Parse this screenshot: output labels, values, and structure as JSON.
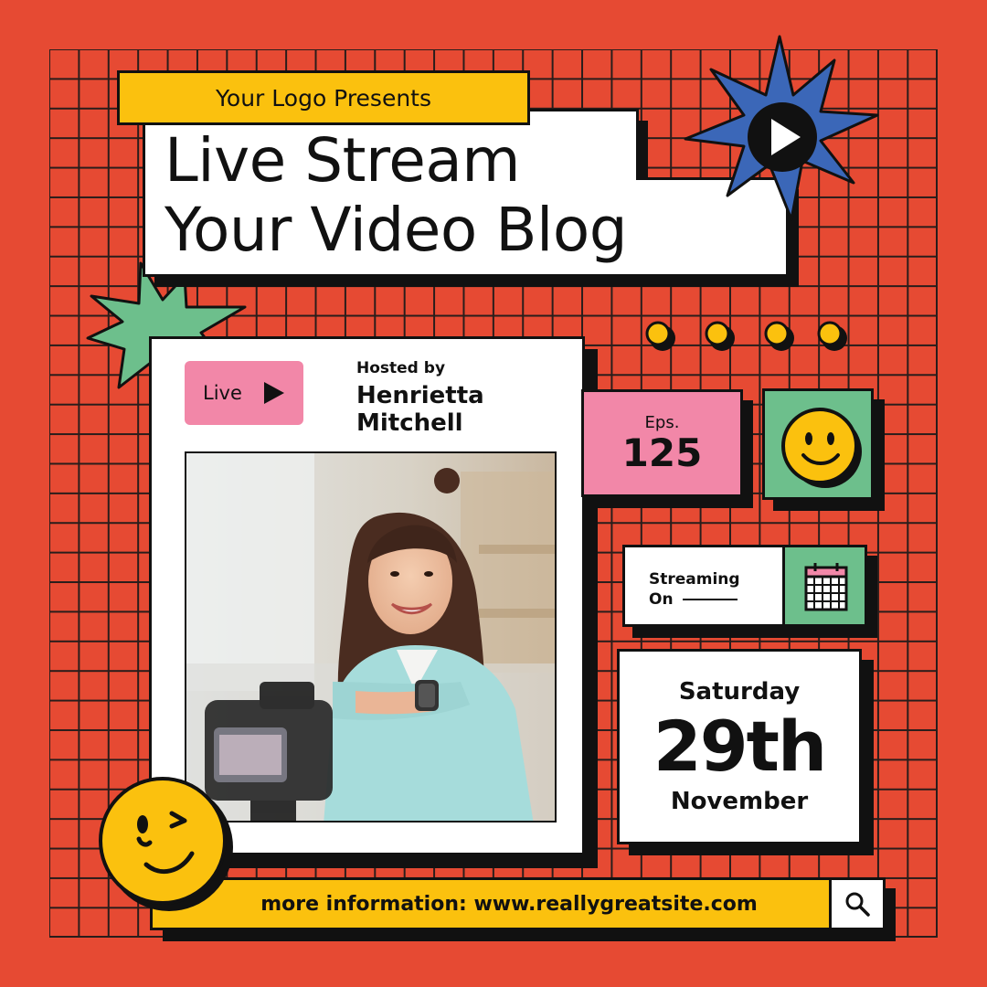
{
  "header": {
    "presents": "Your Logo Presents",
    "title_line1": "Live Stream",
    "title_line2": "Your Video Blog"
  },
  "card": {
    "live_label": "Live",
    "hosted_by": "Hosted by",
    "host_name": "Henrietta Mitchell"
  },
  "episode": {
    "label": "Eps.",
    "number": "125"
  },
  "streaming": {
    "label_line1": "Streaming",
    "label_line2": "On"
  },
  "date": {
    "weekday": "Saturday",
    "day": "29th",
    "month": "November"
  },
  "footer": {
    "info": "more information: www.reallygreatsite.com"
  },
  "icons": [
    "play-icon",
    "smiley-icon",
    "winking-smiley-icon",
    "calendar-icon",
    "search-icon",
    "starburst-icon"
  ],
  "colors": {
    "background": "#e64a33",
    "yellow": "#fbc10e",
    "pink": "#f287a8",
    "green": "#6dbf8c",
    "blue": "#3b67b8"
  }
}
